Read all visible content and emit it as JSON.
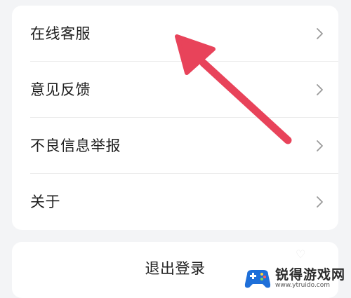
{
  "menu": {
    "items": [
      {
        "label": "在线客服"
      },
      {
        "label": "意见反馈"
      },
      {
        "label": "不良信息举报"
      },
      {
        "label": "关于"
      }
    ]
  },
  "logout": {
    "label": "退出登录"
  },
  "annotation": {
    "color": "#e8435a"
  },
  "watermark": {
    "name": "锐得游戏网",
    "url": "www.ytruido.com"
  }
}
